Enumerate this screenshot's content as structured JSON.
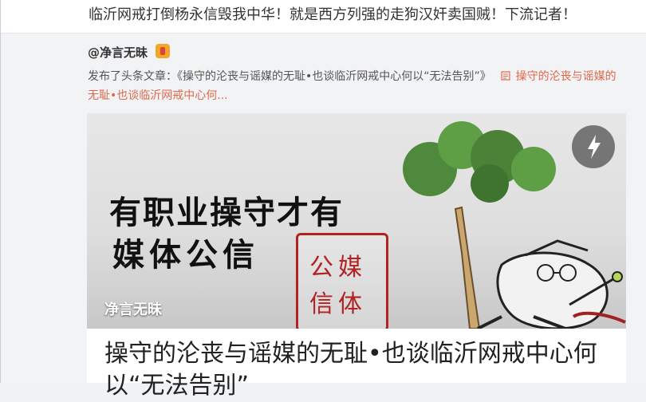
{
  "top_post": {
    "text": "临沂网戒打倒杨永信毁我中华！就是西方列强的走狗汉奸卖国贼！下流记者！"
  },
  "repost": {
    "author": "@净言无昧",
    "description_prefix": "发布了头条文章：《操守的沦丧与谣媒的无耻•也谈临沂网戒中心何以“无法告别”》",
    "article_link_text": "操守的沦丧与谣媒的无耻•也谈临沂网戒中心何...",
    "link_icon": "article-icon"
  },
  "article": {
    "banner_line1": "有职业操守才有",
    "banner_line2": "媒体公信",
    "seal_text": "公媒信体",
    "banner_author": "净言无昧",
    "title": "操守的沦丧与谣媒的无耻•也谈临沂网戒中心何以“无法告别”",
    "flash_icon": "lightning-icon"
  },
  "colors": {
    "link": "#e0684b",
    "seal": "#b22222"
  }
}
